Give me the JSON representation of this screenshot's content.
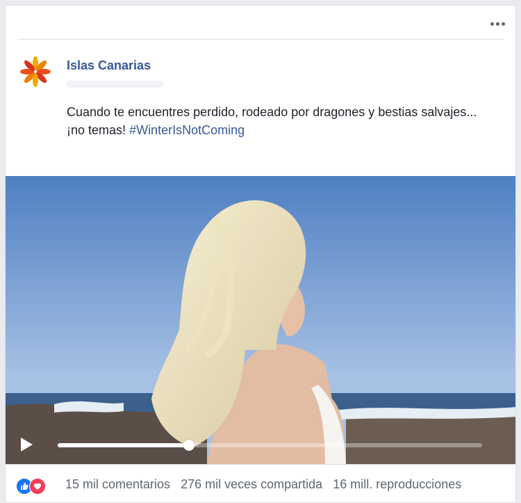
{
  "post": {
    "page_name": "Islas Canarias",
    "text_line1": "Cuando te encuentres perdido, rodeado por dragones y bestias salvajes...",
    "text_line2": "¡no temas!",
    "hashtag": "#WinterIsNotComing",
    "logo_icon": "orange-flower-logo-icon",
    "options_icon": "more-options-icon"
  },
  "video": {
    "play_icon": "play-icon",
    "progress": 0.31
  },
  "footer": {
    "reaction_icons": [
      "like-icon",
      "love-icon"
    ],
    "comments": "15 mil comentarios",
    "shares": "276 mil veces compartida",
    "views": "16 mill. reproducciones"
  },
  "colors": {
    "link": "#365899",
    "like": "#1877f2",
    "love": "#f33e58"
  }
}
